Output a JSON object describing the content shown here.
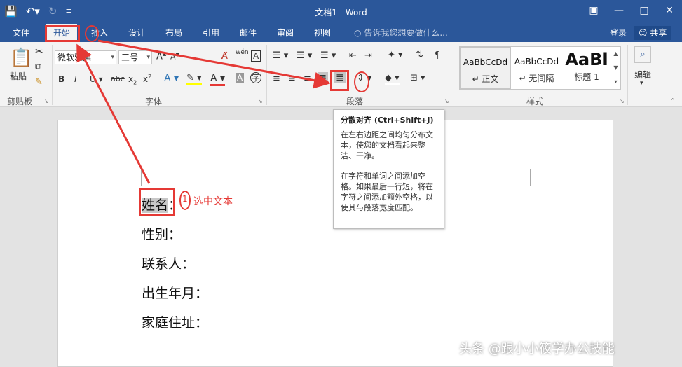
{
  "window": {
    "title": "文档1 - Word",
    "qat_icons": [
      "save-icon",
      "undo-icon",
      "redo-icon",
      "customize-icon"
    ]
  },
  "tabs": [
    {
      "label": "文件"
    },
    {
      "label": "开始"
    },
    {
      "label": "插入"
    },
    {
      "label": "设计"
    },
    {
      "label": "布局"
    },
    {
      "label": "引用"
    },
    {
      "label": "邮件"
    },
    {
      "label": "审阅"
    },
    {
      "label": "视图"
    }
  ],
  "tell_me": "告诉我您想要做什么...",
  "account": {
    "login": "登录",
    "share": "共享"
  },
  "ribbon": {
    "clipboard": {
      "label": "剪贴板",
      "paste": "粘贴"
    },
    "font": {
      "label": "字体",
      "family": "微软雅黑",
      "size": "三号"
    },
    "paragraph": {
      "label": "段落"
    },
    "styles": {
      "label": "样式",
      "items": [
        {
          "preview": "AaBbCcDd",
          "name": "↵ 正文"
        },
        {
          "preview": "AaBbCcDd",
          "name": "↵ 无间隔"
        },
        {
          "preview": "AaBl",
          "name": "标题 1"
        }
      ]
    },
    "editing": {
      "label": "编辑"
    }
  },
  "tooltip": {
    "title": "分散对齐 (Ctrl+Shift+J)",
    "para1": "在左右边距之间均匀分布文本，使您的文档看起来整洁、干净。",
    "para2": "在字符和单词之间添加空格。如果最后一行短，将在字符之间添加额外空格，以使其与段落宽度匹配。"
  },
  "document": {
    "lines": [
      "姓名",
      "性别：",
      "联系人：",
      "出生年月：",
      "家庭住址："
    ],
    "colon": "："
  },
  "annotation": {
    "step": "1",
    "text": "选中文本"
  },
  "watermark": "头条 @跟小小筱学办公技能",
  "colors": {
    "brand": "#2b579a",
    "annotation": "#e53935"
  }
}
